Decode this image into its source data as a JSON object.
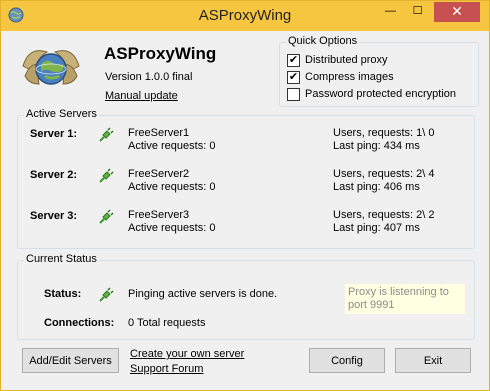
{
  "window": {
    "title": "ASProxyWing"
  },
  "titlebar_buttons": {
    "minimize": "—",
    "maximize": "☐",
    "close": "✕"
  },
  "about": {
    "app_name": "ASProxyWing",
    "version": "Version 1.0.0 final",
    "manual_update": "Manual update"
  },
  "quick_options": {
    "title": "Quick Options",
    "items": [
      {
        "label": "Distributed proxy",
        "checked": true
      },
      {
        "label": "Compress images",
        "checked": true
      },
      {
        "label": "Password protected encryption",
        "checked": false
      }
    ]
  },
  "active_servers": {
    "title": "Active Servers",
    "servers": [
      {
        "label": "Server 1:",
        "name": "FreeServer1",
        "active": "Active requests: 0",
        "users": "Users, requests: 1\\ 0",
        "ping": "Last ping: 434 ms"
      },
      {
        "label": "Server 2:",
        "name": "FreeServer2",
        "active": "Active requests: 0",
        "users": "Users, requests: 2\\ 4",
        "ping": "Last ping: 406 ms"
      },
      {
        "label": "Server 3:",
        "name": "FreeServer3",
        "active": "Active requests: 0",
        "users": "Users, requests: 2\\ 2",
        "ping": "Last ping: 407 ms"
      }
    ]
  },
  "current_status": {
    "title": "Current Status",
    "status_label": "Status:",
    "status_text": "Pinging active servers is done.",
    "connections_label": "Connections:",
    "connections_text": "0 Total requests",
    "notice_line1": "Proxy is listenning to",
    "notice_line2": "port 9991"
  },
  "footer": {
    "add_edit": "Add/Edit Servers",
    "create_server": "Create your own server",
    "support_forum": "Support Forum",
    "config": "Config",
    "exit": "Exit"
  },
  "colors": {
    "titlebar": "#f6c641",
    "close_button": "#c75050",
    "notice_bg": "#ffffe1",
    "plug_green": "#3c9a2d"
  }
}
